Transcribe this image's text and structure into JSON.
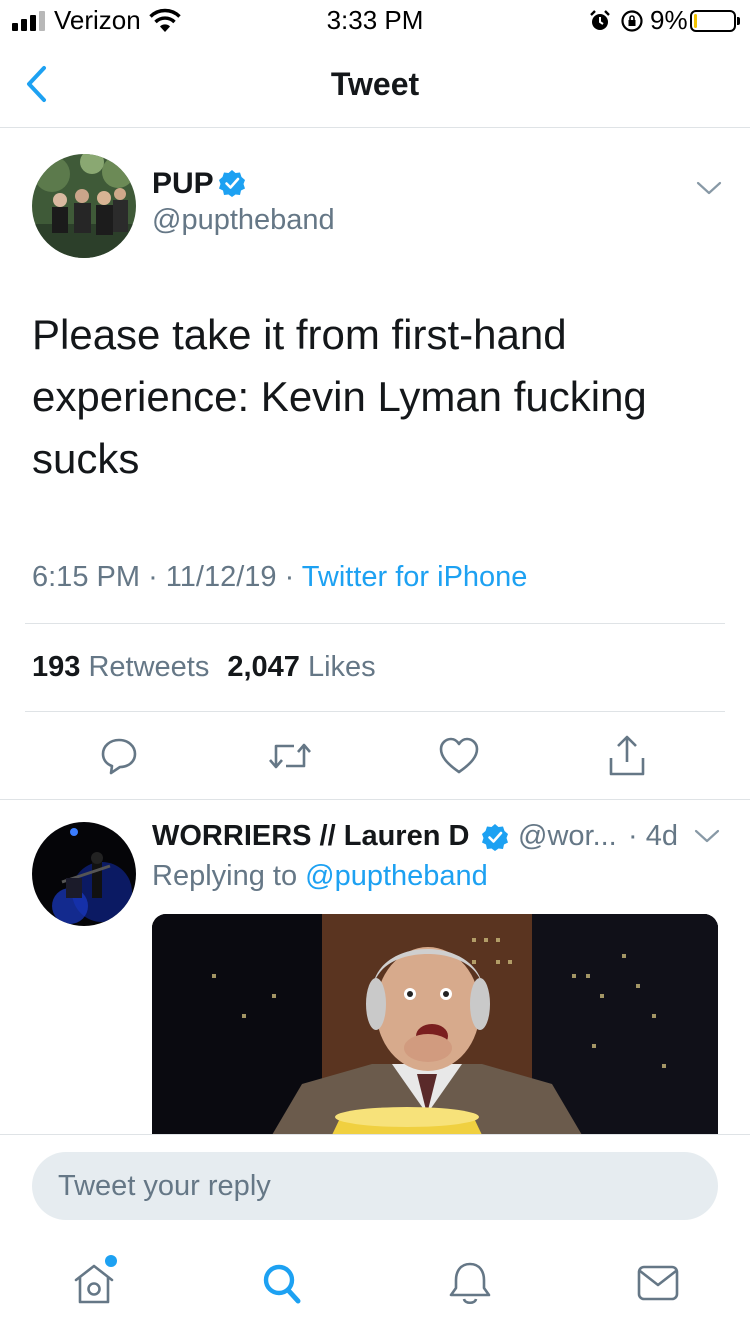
{
  "status_bar": {
    "carrier": "Verizon",
    "time": "3:33 PM",
    "battery_percent": "9%",
    "battery_level": 0.09,
    "battery_color": "#f2c300"
  },
  "nav": {
    "back_icon": "chevron-left-icon",
    "title": "Tweet"
  },
  "tweet": {
    "author_name": "PUP",
    "author_handle": "@puptheband",
    "verified": true,
    "text": "Please take it from first-hand experience: Kevin Lyman fucking sucks",
    "time": "6:15 PM",
    "date": "11/12/19",
    "source": "Twitter for iPhone",
    "retweets_count": "193",
    "retweets_label": "Retweets",
    "likes_count": "2,047",
    "likes_label": "Likes",
    "actions": [
      "reply-icon",
      "retweet-icon",
      "like-icon",
      "share-icon"
    ]
  },
  "reply": {
    "author_name": "WORRIERS // Lauren D",
    "author_handle": "@wor...",
    "verified": true,
    "age": "· 4d",
    "replying_prefix": "Replying to",
    "replying_to": "@puptheband"
  },
  "composer": {
    "placeholder": "Tweet your reply"
  },
  "tab_bar": {
    "tabs": [
      "home-icon",
      "search-icon",
      "notifications-icon",
      "messages-icon"
    ],
    "home_has_new": true
  },
  "colors": {
    "accent": "#1da1f2",
    "secondary_text": "#657786",
    "divider": "#dfe3e6"
  }
}
